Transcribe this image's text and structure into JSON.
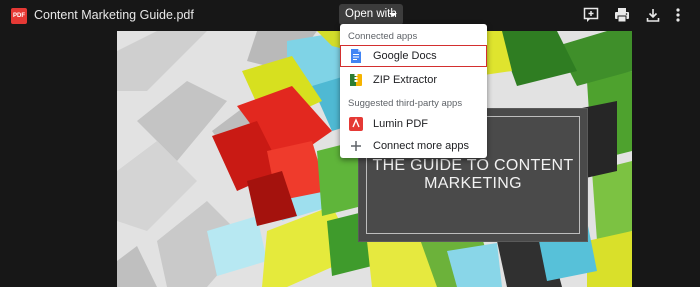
{
  "header": {
    "file_badge": "PDF",
    "file_title": "Content Marketing Guide.pdf",
    "open_with_label": "Open with",
    "actions": [
      {
        "name": "add-comment-icon"
      },
      {
        "name": "print-icon"
      },
      {
        "name": "download-icon"
      },
      {
        "name": "more-options-icon"
      }
    ]
  },
  "menu": {
    "connected_header": "Connected apps",
    "connected_items": [
      {
        "label": "Google Docs",
        "icon": "google-docs-icon",
        "selected": true
      },
      {
        "label": "ZIP Extractor",
        "icon": "zip-extractor-icon"
      }
    ],
    "suggested_header": "Suggested third-party apps",
    "suggested_items": [
      {
        "label": "Lumin PDF",
        "icon": "lumin-pdf-icon"
      },
      {
        "label": "Connect more apps",
        "icon": "plus-icon"
      }
    ]
  },
  "document": {
    "cover_title": "THE GUIDE TO CONTENT MARKETING"
  },
  "colors": {
    "background": "#171717",
    "selection_outline": "#d32f2f",
    "pdf_badge": "#e53935",
    "docs_blue": "#4285f4"
  }
}
